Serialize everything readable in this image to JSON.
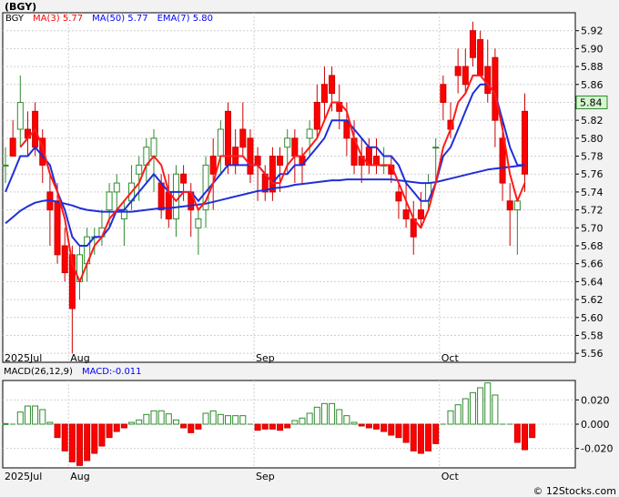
{
  "chart_data": [
    {
      "type": "candlestick",
      "symbol": "(BGY)",
      "legend": [
        {
          "label": "BGY",
          "color": "#000000"
        },
        {
          "label": "MA(3)",
          "value": "5.77",
          "color": "#ff0000"
        },
        {
          "label": "MA(50)",
          "value": "5.77",
          "color": "#0000ff"
        },
        {
          "label": "EMA(7)",
          "value": "5.80",
          "color": "#0000ff"
        }
      ],
      "ylim": [
        5.55,
        5.94
      ],
      "y_ticks": [
        "5.56",
        "5.58",
        "5.60",
        "5.62",
        "5.64",
        "5.66",
        "5.68",
        "5.70",
        "5.72",
        "5.74",
        "5.76",
        "5.78",
        "5.80",
        "5.82",
        "5.84",
        "5.86",
        "5.88",
        "5.90",
        "5.92"
      ],
      "x_labels": [
        "2025Jul",
        "Aug",
        "Sep",
        "Oct"
      ],
      "x_label_index": [
        0,
        9,
        34,
        59
      ],
      "last_price": "5.84",
      "candles": [
        [
          5.77,
          5.79,
          5.75,
          5.77
        ],
        [
          5.8,
          5.82,
          5.78,
          5.78
        ],
        [
          5.81,
          5.87,
          5.79,
          5.84
        ],
        [
          5.81,
          5.83,
          5.78,
          5.8
        ],
        [
          5.83,
          5.84,
          5.78,
          5.79
        ],
        [
          5.8,
          5.81,
          5.75,
          5.77
        ],
        [
          5.74,
          5.76,
          5.68,
          5.72
        ],
        [
          5.73,
          5.75,
          5.66,
          5.67
        ],
        [
          5.68,
          5.7,
          5.64,
          5.65
        ],
        [
          5.67,
          5.68,
          5.56,
          5.61
        ],
        [
          5.64,
          5.68,
          5.62,
          5.67
        ],
        [
          5.66,
          5.7,
          5.64,
          5.69
        ],
        [
          5.69,
          5.7,
          5.67,
          5.69
        ],
        [
          5.69,
          5.72,
          5.68,
          5.7
        ],
        [
          5.72,
          5.75,
          5.7,
          5.74
        ],
        [
          5.74,
          5.76,
          5.72,
          5.75
        ],
        [
          5.71,
          5.73,
          5.68,
          5.72
        ],
        [
          5.73,
          5.77,
          5.72,
          5.75
        ],
        [
          5.76,
          5.78,
          5.73,
          5.77
        ],
        [
          5.77,
          5.8,
          5.75,
          5.79
        ],
        [
          5.78,
          5.81,
          5.74,
          5.8
        ],
        [
          5.75,
          5.76,
          5.71,
          5.72
        ],
        [
          5.74,
          5.76,
          5.7,
          5.71
        ],
        [
          5.71,
          5.77,
          5.69,
          5.76
        ],
        [
          5.76,
          5.77,
          5.73,
          5.75
        ],
        [
          5.74,
          5.75,
          5.69,
          5.72
        ],
        [
          5.7,
          5.72,
          5.67,
          5.71
        ],
        [
          5.72,
          5.78,
          5.7,
          5.77
        ],
        [
          5.78,
          5.8,
          5.72,
          5.76
        ],
        [
          5.78,
          5.82,
          5.76,
          5.81
        ],
        [
          5.83,
          5.84,
          5.76,
          5.77
        ],
        [
          5.79,
          5.81,
          5.76,
          5.77
        ],
        [
          5.81,
          5.84,
          5.78,
          5.79
        ],
        [
          5.8,
          5.81,
          5.75,
          5.76
        ],
        [
          5.78,
          5.79,
          5.73,
          5.77
        ],
        [
          5.76,
          5.77,
          5.73,
          5.74
        ],
        [
          5.78,
          5.79,
          5.73,
          5.74
        ],
        [
          5.78,
          5.79,
          5.74,
          5.77
        ],
        [
          5.79,
          5.81,
          5.76,
          5.8
        ],
        [
          5.8,
          5.81,
          5.75,
          5.78
        ],
        [
          5.78,
          5.79,
          5.75,
          5.77
        ],
        [
          5.8,
          5.82,
          5.78,
          5.81
        ],
        [
          5.84,
          5.86,
          5.8,
          5.81
        ],
        [
          5.86,
          5.88,
          5.82,
          5.84
        ],
        [
          5.87,
          5.88,
          5.83,
          5.85
        ],
        [
          5.84,
          5.86,
          5.81,
          5.83
        ],
        [
          5.82,
          5.84,
          5.78,
          5.8
        ],
        [
          5.8,
          5.82,
          5.76,
          5.77
        ],
        [
          5.78,
          5.8,
          5.75,
          5.77
        ],
        [
          5.79,
          5.8,
          5.76,
          5.77
        ],
        [
          5.78,
          5.8,
          5.76,
          5.77
        ],
        [
          5.77,
          5.79,
          5.76,
          5.77
        ],
        [
          5.77,
          5.78,
          5.75,
          5.76
        ],
        [
          5.74,
          5.75,
          5.71,
          5.73
        ],
        [
          5.72,
          5.75,
          5.7,
          5.71
        ],
        [
          5.71,
          5.73,
          5.67,
          5.69
        ],
        [
          5.72,
          5.74,
          5.7,
          5.71
        ],
        [
          5.73,
          5.76,
          5.72,
          5.75
        ],
        [
          5.79,
          5.8,
          5.75,
          5.79
        ],
        [
          5.86,
          5.87,
          5.82,
          5.84
        ],
        [
          5.82,
          5.84,
          5.8,
          5.81
        ],
        [
          5.88,
          5.9,
          5.85,
          5.87
        ],
        [
          5.88,
          5.9,
          5.85,
          5.86
        ],
        [
          5.92,
          5.93,
          5.88,
          5.89
        ],
        [
          5.91,
          5.92,
          5.87,
          5.87
        ],
        [
          5.88,
          5.91,
          5.84,
          5.85
        ],
        [
          5.89,
          5.9,
          5.79,
          5.82
        ],
        [
          5.8,
          5.82,
          5.73,
          5.75
        ],
        [
          5.73,
          5.75,
          5.68,
          5.72
        ],
        [
          5.72,
          5.73,
          5.67,
          5.73
        ],
        [
          5.83,
          5.85,
          5.74,
          5.76
        ]
      ],
      "ma3": [
        null,
        null,
        5.79,
        5.8,
        5.81,
        5.79,
        5.76,
        5.74,
        5.71,
        5.66,
        5.64,
        5.66,
        5.68,
        5.69,
        5.71,
        5.72,
        5.73,
        5.74,
        5.75,
        5.77,
        5.78,
        5.77,
        5.74,
        5.73,
        5.74,
        5.74,
        5.72,
        5.73,
        5.75,
        5.78,
        5.78,
        5.78,
        5.78,
        5.77,
        5.77,
        5.76,
        5.75,
        5.75,
        5.77,
        5.78,
        5.78,
        5.79,
        5.8,
        5.82,
        5.84,
        5.84,
        5.83,
        5.8,
        5.78,
        5.77,
        5.77,
        5.77,
        5.77,
        5.75,
        5.73,
        5.71,
        5.7,
        5.72,
        5.75,
        5.79,
        5.81,
        5.84,
        5.85,
        5.87,
        5.87,
        5.86,
        5.85,
        5.81,
        5.76,
        5.73,
        5.75
      ],
      "ema7": [
        5.74,
        5.76,
        5.78,
        5.78,
        5.79,
        5.78,
        5.77,
        5.74,
        5.72,
        5.69,
        5.68,
        5.68,
        5.69,
        5.69,
        5.7,
        5.72,
        5.72,
        5.73,
        5.74,
        5.75,
        5.76,
        5.75,
        5.74,
        5.74,
        5.74,
        5.74,
        5.73,
        5.74,
        5.75,
        5.76,
        5.77,
        5.77,
        5.77,
        5.77,
        5.77,
        5.76,
        5.75,
        5.76,
        5.76,
        5.77,
        5.77,
        5.78,
        5.79,
        5.8,
        5.82,
        5.82,
        5.82,
        5.81,
        5.8,
        5.79,
        5.79,
        5.78,
        5.78,
        5.77,
        5.75,
        5.74,
        5.73,
        5.73,
        5.75,
        5.78,
        5.79,
        5.81,
        5.83,
        5.85,
        5.86,
        5.86,
        5.85,
        5.82,
        5.79,
        5.77,
        5.77
      ],
      "ma50": [
        5.705,
        5.712,
        5.719,
        5.724,
        5.728,
        5.73,
        5.731,
        5.729,
        5.727,
        5.725,
        5.722,
        5.72,
        5.719,
        5.718,
        5.718,
        5.718,
        5.718,
        5.718,
        5.719,
        5.72,
        5.721,
        5.722,
        5.722,
        5.723,
        5.724,
        5.725,
        5.726,
        5.727,
        5.729,
        5.731,
        5.733,
        5.735,
        5.737,
        5.739,
        5.741,
        5.742,
        5.744,
        5.745,
        5.746,
        5.748,
        5.749,
        5.75,
        5.751,
        5.752,
        5.753,
        5.753,
        5.754,
        5.754,
        5.754,
        5.754,
        5.754,
        5.754,
        5.754,
        5.753,
        5.752,
        5.751,
        5.75,
        5.75,
        5.751,
        5.753,
        5.755,
        5.757,
        5.759,
        5.761,
        5.763,
        5.765,
        5.766,
        5.767,
        5.768,
        5.769,
        5.77
      ]
    },
    {
      "type": "bar",
      "legend": [
        {
          "label": "MACD(26,12,9)",
          "color": "#000000"
        },
        {
          "label": "MACD:",
          "value": "-0.011",
          "color": "#0000ff"
        }
      ],
      "ylim": [
        -0.036,
        0.036
      ],
      "y_ticks": [
        "0.020",
        "0.000",
        "-0.020"
      ],
      "y_tick_values": [
        0.02,
        0.0,
        -0.02
      ],
      "x_labels": [
        "2025Jul",
        "Aug",
        "Sep",
        "Oct"
      ],
      "values": [
        0.0005,
        0.0,
        0.01,
        0.015,
        0.015,
        0.012,
        0.0015,
        -0.011,
        -0.022,
        -0.031,
        -0.034,
        -0.03,
        -0.024,
        -0.018,
        -0.011,
        -0.006,
        -0.003,
        0.0015,
        0.0035,
        0.008,
        0.011,
        0.011,
        0.0085,
        0.0035,
        -0.003,
        -0.007,
        -0.004,
        0.009,
        0.011,
        0.008,
        0.007,
        0.007,
        0.007,
        0.0,
        -0.005,
        -0.004,
        -0.004,
        -0.005,
        -0.003,
        0.003,
        0.005,
        0.009,
        0.014,
        0.017,
        0.017,
        0.012,
        0.007,
        0.0015,
        -0.0015,
        -0.003,
        -0.004,
        -0.006,
        -0.009,
        -0.011,
        -0.015,
        -0.022,
        -0.024,
        -0.022,
        -0.016,
        0.0,
        0.011,
        0.016,
        0.021,
        0.026,
        0.03,
        0.034,
        0.024,
        0.0,
        0.0,
        -0.015,
        -0.021,
        -0.011
      ]
    }
  ],
  "footer": {
    "copyright": "© 12Stocks.com"
  }
}
